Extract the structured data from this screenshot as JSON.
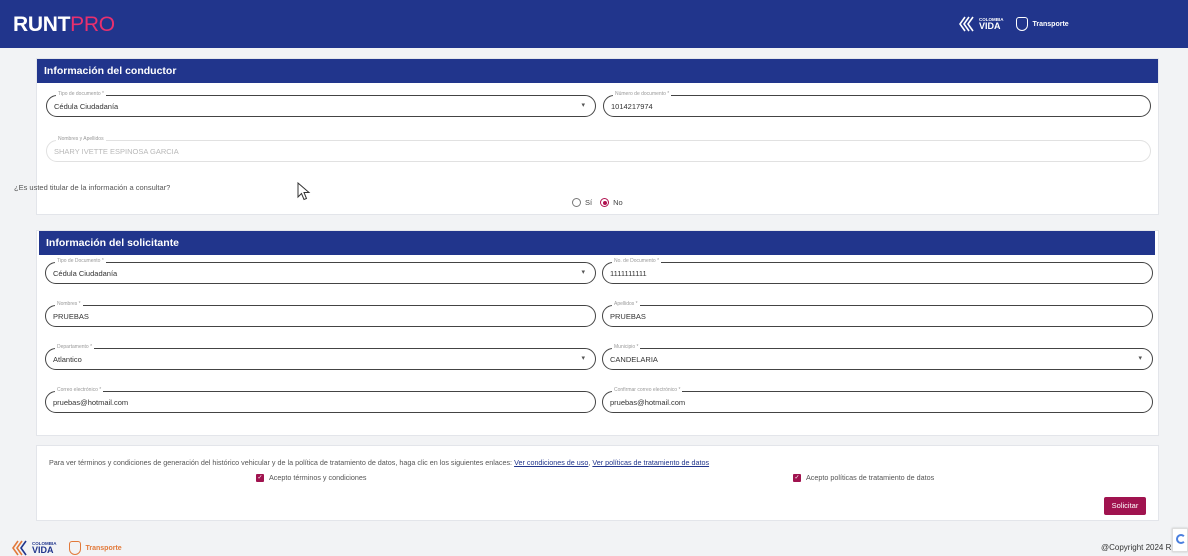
{
  "header": {
    "brand_bold": "RUNT",
    "brand_light": "PRO",
    "logo1_small": "COLOMBIA",
    "logo1_big": "VIDA",
    "logo2": "Transporte"
  },
  "conductor": {
    "title": "Información del conductor",
    "doc_type": {
      "label": "Tipo de documento *",
      "value": "Cédula Ciudadanía"
    },
    "doc_number": {
      "label": "Número de documento *",
      "value": "1014217974"
    },
    "full_name": {
      "label": "Nombres y Apellidos",
      "value": "SHARY IVETTE ESPINOSA GARCIA"
    },
    "question": "¿Es usted titular de la información a consultar?",
    "options": {
      "yes": "Sí",
      "no": "No",
      "selected": "No"
    }
  },
  "solicitante": {
    "title": "Información del solicitante",
    "doc_type": {
      "label": "Tipo de Documento *",
      "value": "Cédula Ciudadanía"
    },
    "doc_number": {
      "label": "No. de Documento *",
      "value": "1111111111"
    },
    "names": {
      "label": "Nombres *",
      "value": "PRUEBAS"
    },
    "surnames": {
      "label": "Apellidos *",
      "value": "PRUEBAS"
    },
    "department": {
      "label": "Departamento *",
      "value": "Atlantico"
    },
    "municipality": {
      "label": "Municipio *",
      "value": "CANDELARIA"
    },
    "email": {
      "label": "Correo electrónico *",
      "value": "pruebas@hotmail.com"
    },
    "email_confirm": {
      "label": "Confirmar correo electrónico *",
      "value": "pruebas@hotmail.com"
    }
  },
  "terms": {
    "text": "Para ver términos y condiciones de generación del histórico vehicular y de la política de tratamiento de datos, haga clic en los siguientes enlaces:",
    "link_terms": "Ver condiciones de uso",
    "separator": ",",
    "link_policy": "Ver políticas de tratamiento de datos",
    "accept_terms": "Acepto términos y condiciones",
    "accept_policy": "Acepto políticas de tratamiento de datos",
    "accept_terms_checked": true,
    "accept_policy_checked": true,
    "submit": "Solicitar"
  },
  "footer": {
    "logo1_small": "COLOMBIA",
    "logo1_big": "VIDA",
    "logo2": "Transporte",
    "copyright": "@Copyright 2024 R"
  },
  "colors": {
    "primary": "#21358c",
    "accent": "#a0134f",
    "brand_pink": "#e8306e"
  },
  "icons": {
    "select_caret": "chevron-down-icon",
    "checkbox": "check-icon",
    "recaptcha": "recaptcha-icon",
    "cursor": "cursor-icon"
  }
}
